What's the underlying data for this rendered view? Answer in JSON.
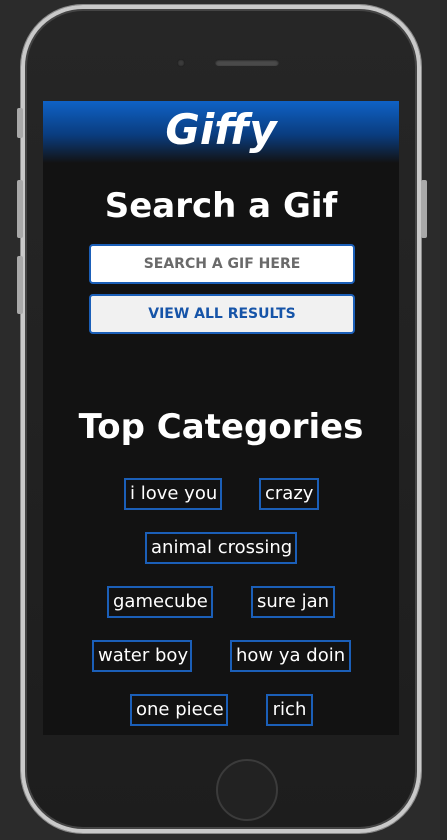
{
  "app": {
    "title": "Giffy"
  },
  "search": {
    "heading": "Search a Gif",
    "placeholder": "SEARCH A GIF HERE",
    "view_all_label": "VIEW ALL RESULTS"
  },
  "categories": {
    "heading": "Top Categories",
    "items": [
      {
        "label": "i love you"
      },
      {
        "label": "crazy"
      },
      {
        "label": "animal crossing"
      },
      {
        "label": "gamecube"
      },
      {
        "label": "sure jan"
      },
      {
        "label": "water boy"
      },
      {
        "label": "how ya doin"
      },
      {
        "label": "one piece"
      },
      {
        "label": "rich"
      }
    ]
  },
  "colors": {
    "accent": "#1b5fb8",
    "header_top": "#0f62c6",
    "background": "#121212"
  }
}
